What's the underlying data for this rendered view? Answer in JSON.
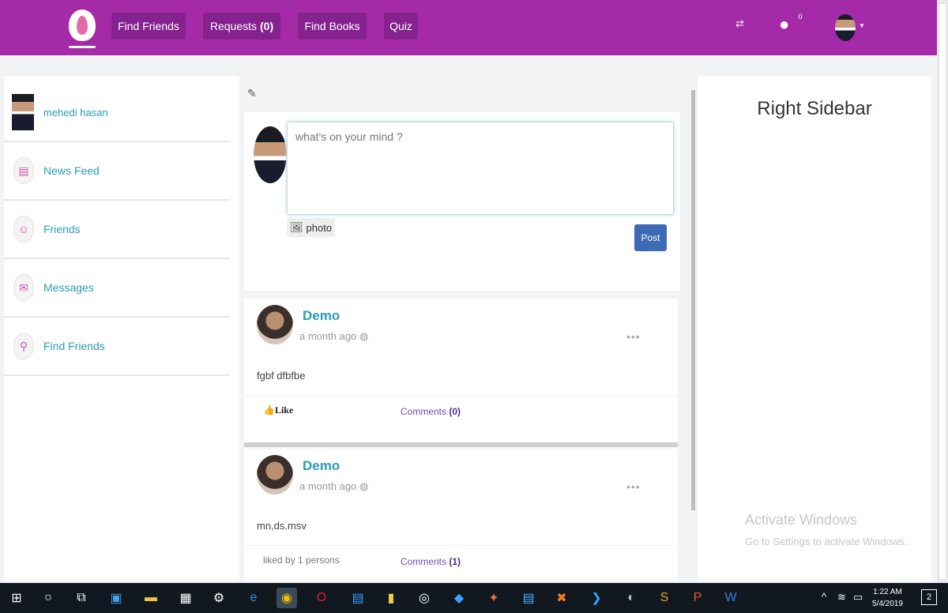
{
  "navbar": {
    "buttons": [
      {
        "label": "Find Friends"
      },
      {
        "label": "Requests",
        "count": "(0)"
      },
      {
        "label": "Find Books"
      },
      {
        "label": "Quiz"
      }
    ],
    "notification_count": "0",
    "accent_color": "#a52aa8"
  },
  "sidebar": {
    "profile_name": "mehedi hasan",
    "items": [
      {
        "label": "News Feed",
        "icon": "newsfeed-icon"
      },
      {
        "label": "Friends",
        "icon": "friends-icon"
      },
      {
        "label": "Messages",
        "icon": "messages-icon"
      },
      {
        "label": "Find Friends",
        "icon": "find-friends-icon"
      }
    ]
  },
  "composer": {
    "placeholder": "what's on your mind ?",
    "photo_label": "photo",
    "post_label": "Post"
  },
  "posts": [
    {
      "author": "Demo",
      "time": "a month ago",
      "text": "fgbf dfbfbe",
      "action": "Like",
      "comments_label": "Comments",
      "comments_count": "(0)"
    },
    {
      "author": "Demo",
      "time": "a month ago",
      "text": "mn,ds.msv",
      "liked_by": "liked by 1 persons",
      "comments_label": "Comments",
      "comments_count": "(1)"
    }
  ],
  "right_sidebar": {
    "title": "Right Sidebar",
    "watermark_title": "Activate Windows",
    "watermark_sub": "Go to Settings to activate Windows."
  },
  "taskbar": {
    "time": "1:22 AM",
    "date": "5/4/2019",
    "notification_count": "2"
  }
}
